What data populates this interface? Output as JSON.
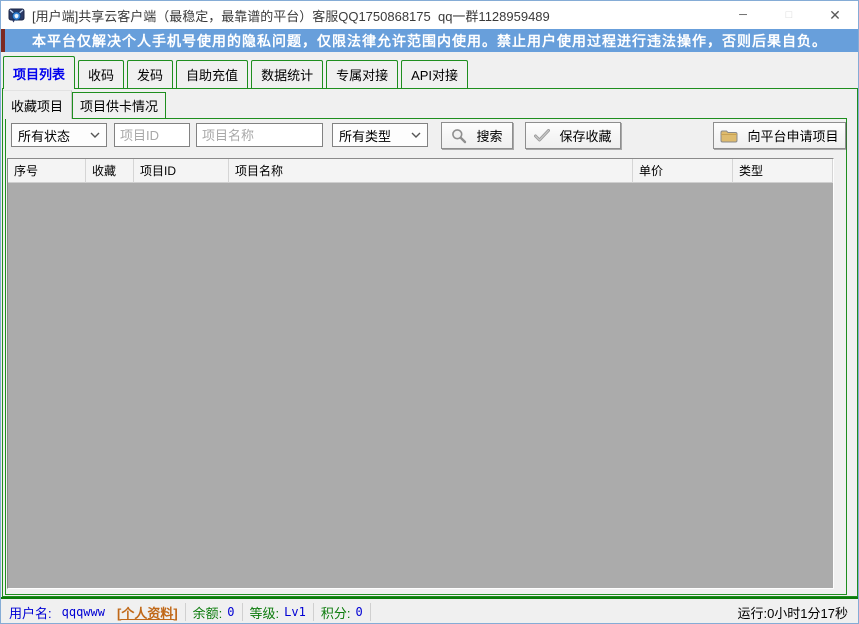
{
  "window": {
    "title": "[用户端]共享云客户端（最稳定，最靠谱的平台）客服QQ1750868175  qq一群1128959489"
  },
  "icons": {
    "app": "chat-shield",
    "minimize": "─",
    "maximize": "□",
    "close": "✕",
    "search": "magnifier",
    "save": "checkmark",
    "apply": "folder",
    "combo": "chevron-down"
  },
  "banner": {
    "text": "本平台仅解决个人手机号使用的隐私问题，仅限法律允许范围内使用。禁止用户使用过程进行违法操作，否则后果自负。"
  },
  "main_tabs": [
    {
      "label": "项目列表",
      "selected": true
    },
    {
      "label": "收码",
      "selected": false
    },
    {
      "label": "发码",
      "selected": false
    },
    {
      "label": "自助充值",
      "selected": false
    },
    {
      "label": "数据统计",
      "selected": false
    },
    {
      "label": "专属对接",
      "selected": false
    },
    {
      "label": "API对接",
      "selected": false
    }
  ],
  "sub_tabs": [
    {
      "label": "收藏项目",
      "selected": true
    },
    {
      "label": "项目供卡情况",
      "selected": false
    }
  ],
  "filters": {
    "status_value": "所有状态",
    "project_id_placeholder": "项目ID",
    "project_name_placeholder": "项目名称",
    "type_value": "所有类型",
    "search_label": "搜索",
    "save_label": "保存收藏",
    "apply_label": "向平台申请项目"
  },
  "table": {
    "columns": [
      "序号",
      "收藏",
      "项目ID",
      "项目名称",
      "单价",
      "类型"
    ],
    "rows": []
  },
  "status_bar": {
    "username_label": "用户名:",
    "username": "qqqwww",
    "profile_link": "[个人资料]",
    "balance_label": "余额:",
    "balance": "0",
    "level_label": "等级:",
    "level": "Lv1",
    "points_label": "积分:",
    "points": "0",
    "runtime": "运行:0小时1分17秒"
  },
  "colors": {
    "banner_blue": "#689FDB",
    "tab_border_green": "#1E8E1E",
    "selected_tab_text": "#0000EE",
    "link_orange": "#C06818",
    "status_label_green": "#0B7B0B",
    "status_value_blue": "#0000D4",
    "list_body_gray": "#ABABAB"
  }
}
